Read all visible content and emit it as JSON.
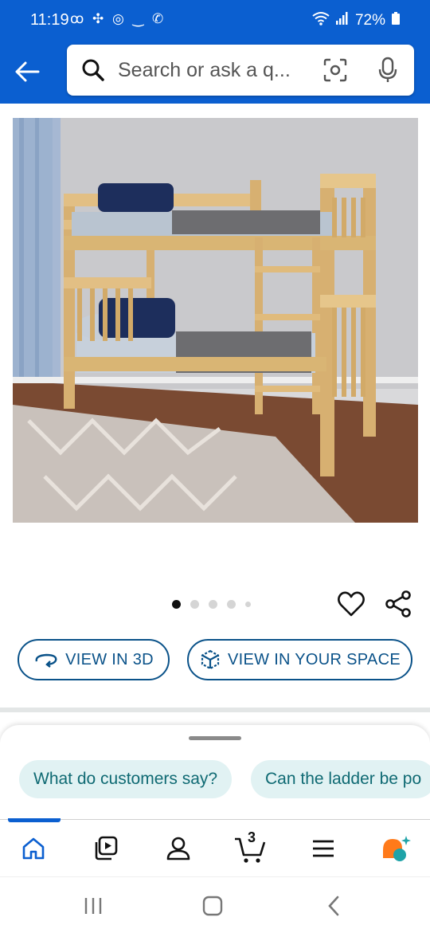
{
  "status_bar": {
    "time": "11:19",
    "left_icons": "ꝏ ✣ ◎ ‿ ✆",
    "battery": "72%"
  },
  "header": {
    "search_placeholder": "Search or ask a q..."
  },
  "product": {
    "image_alt": "Natural wood bunk bed with ladder",
    "carousel": {
      "total": 5,
      "active_index": 1
    }
  },
  "actions": {
    "view_3d_label": "VIEW IN 3D",
    "view_space_label": "VIEW IN YOUR SPACE"
  },
  "sheet": {
    "chips": [
      "What do customers say?",
      "Can the ladder be po"
    ]
  },
  "bottom_nav": {
    "active": "home",
    "cart_count": "3",
    "items": [
      "home-icon",
      "video-icon",
      "account-icon",
      "cart-icon",
      "menu-icon",
      "rufus-icon"
    ]
  },
  "colors": {
    "header_blue": "#0b5fd0",
    "button_border": "#0a5289",
    "chip_bg": "#e1f2f3",
    "chip_text": "#0f6a73"
  }
}
